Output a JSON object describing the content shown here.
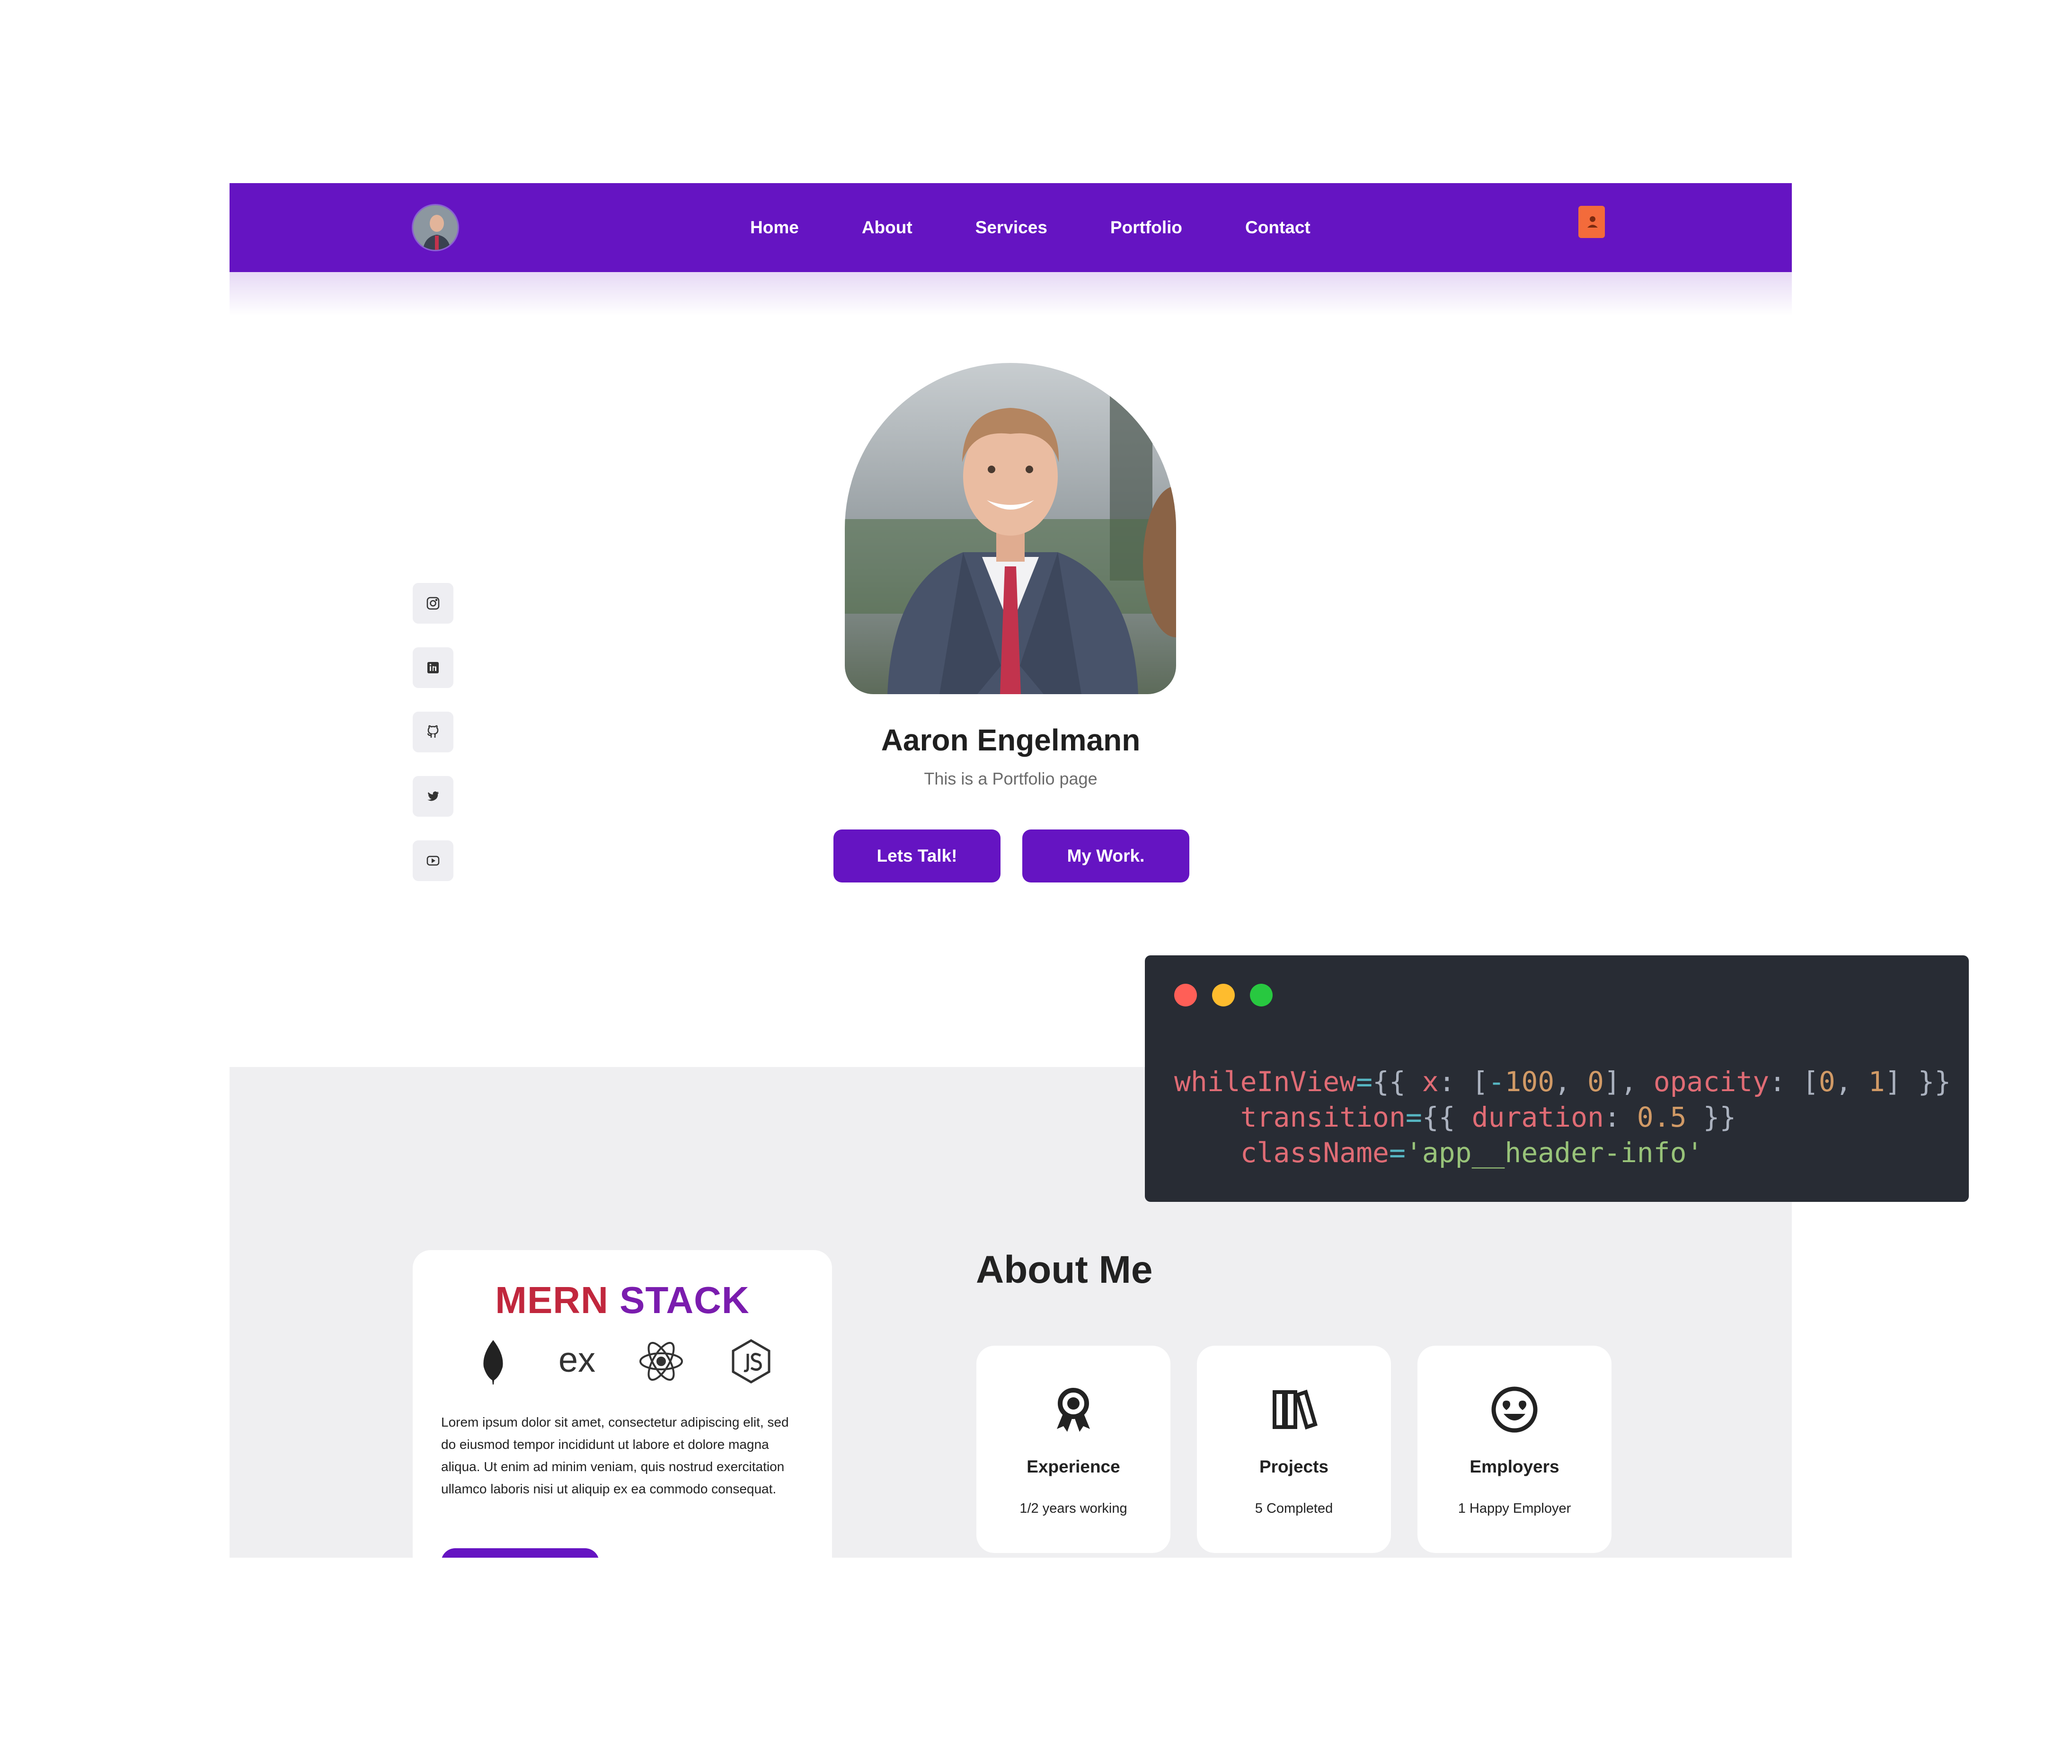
{
  "nav": {
    "links": [
      "Home",
      "About",
      "Services",
      "Portfolio",
      "Contact"
    ]
  },
  "socials": [
    "instagram-icon",
    "linkedin-icon",
    "github-icon",
    "twitter-icon",
    "youtube-icon"
  ],
  "hero": {
    "name": "Aaron Engelmann",
    "subtitle": "This is a Portfolio page",
    "buttons": [
      "Lets Talk!",
      "My Work."
    ]
  },
  "stack": {
    "title_part1": "MERN",
    "title_part2": "STACK",
    "icons": [
      "mongodb-icon",
      "express-icon",
      "react-icon",
      "nodejs-icon"
    ],
    "description": "Lorem ipsum dolor sit amet, consectetur adipiscing elit, sed do eiusmod tempor incididunt ut labore et dolore magna aliqua. Ut enim ad minim veniam, quis nostrud exercitation ullamco laboris nisi ut aliquip ex ea commodo consequat."
  },
  "about": {
    "title": "About Me",
    "stats": [
      {
        "icon": "award-icon",
        "label": "Experience",
        "sub": "1/2 years working"
      },
      {
        "icon": "books-icon",
        "label": "Projects",
        "sub": "5 Completed"
      },
      {
        "icon": "smiley-heart-eyes-icon",
        "label": "Employers",
        "sub": "1 Happy Employer"
      }
    ]
  },
  "code": {
    "line1": "whileInView={{ x: [-100, 0], opacity: [0, 1] }}",
    "line2": "transition={{ duration: 0.5 }}",
    "line3": "className='app__header-info'"
  },
  "colors": {
    "brand": "#6514c2",
    "section_bg": "#efeff1",
    "code_bg": "#282c34",
    "contact_icon": "#f36b3b",
    "gradient_start": "#c1273d",
    "gradient_end": "#3a12c9"
  }
}
